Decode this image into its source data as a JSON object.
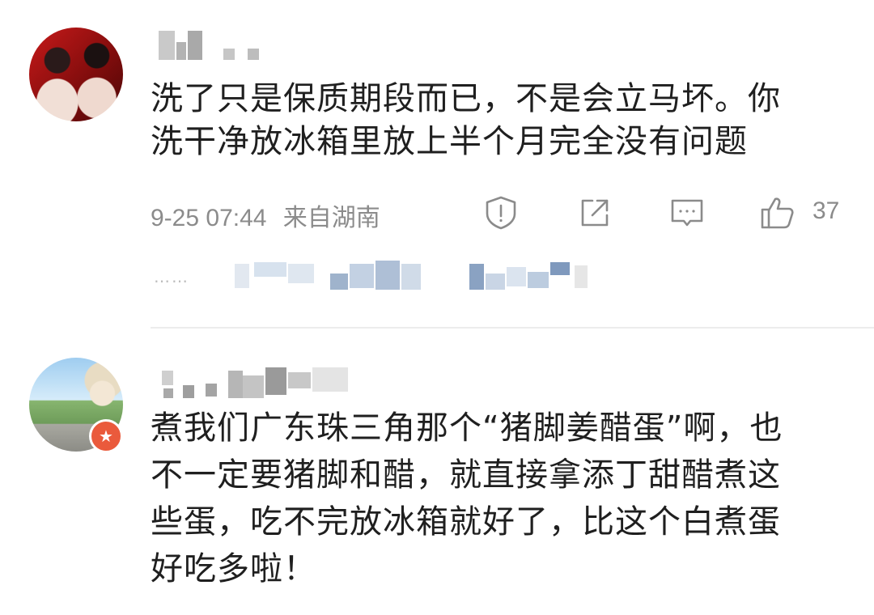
{
  "comments": [
    {
      "text_line1": "洗了只是保质期段而已，不是会立马坏。你",
      "text_line2": "洗干净放冰箱里放上半个月完全没有问题",
      "timestamp": "9-25 07:44",
      "location": "来自湖南",
      "like_count": "37",
      "reply_dots": "……"
    },
    {
      "text_line1": "煮我们广东珠三角那个“猪脚姜醋蛋”啊，也",
      "text_line2": "不一定要猪脚和醋，就直接拿添丁甜醋煮这",
      "text_line3": "些蛋，吃不完放冰箱就好了，比这个白煮蛋",
      "text_line4": "好吃多啦！"
    }
  ],
  "icons": {
    "report": "report-icon",
    "share": "share-icon",
    "reply": "comment-icon",
    "like": "thumbs-up-icon",
    "badge": "star-badge-icon"
  },
  "colors": {
    "meta_gray": "#8b8b8b",
    "badge_red": "#ea5a3c"
  }
}
